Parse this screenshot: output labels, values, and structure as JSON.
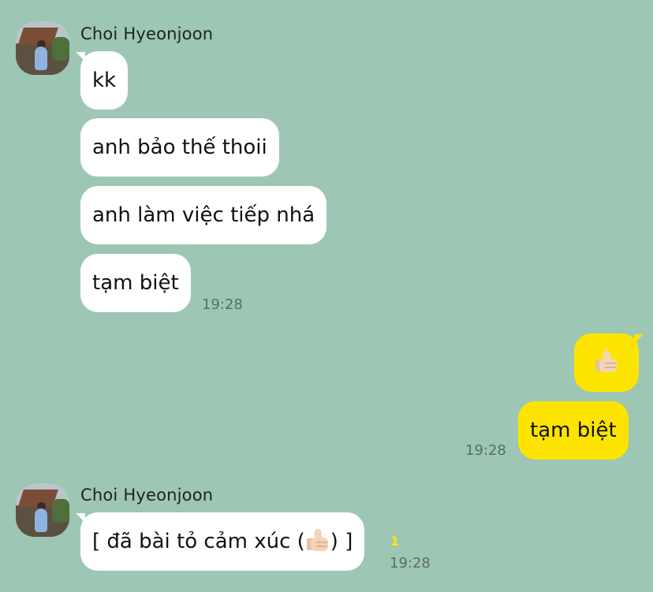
{
  "chat": {
    "groups": [
      {
        "sender": "Choi Hyeonjoon",
        "messages": [
          "kk",
          "anh bảo thế thoii",
          "anh làm việc tiếp nhá",
          "tạm biệt"
        ],
        "time": "19:28"
      },
      {
        "sender": "Choi Hyeonjoon",
        "reaction_prefix": "[ đã bài tỏ cảm xúc (",
        "reaction_suffix": ") ]",
        "reaction_icon": "thumbs-up-icon",
        "unread": "1",
        "time": "19:28"
      }
    ],
    "mine": {
      "sticker": "thumbs-up-icon",
      "message": "tạm biệt",
      "time": "19:28"
    }
  },
  "colors": {
    "background": "#9dc6b4",
    "incoming_bubble": "#ffffff",
    "outgoing_bubble": "#fde400",
    "unread": "#fbe900"
  }
}
